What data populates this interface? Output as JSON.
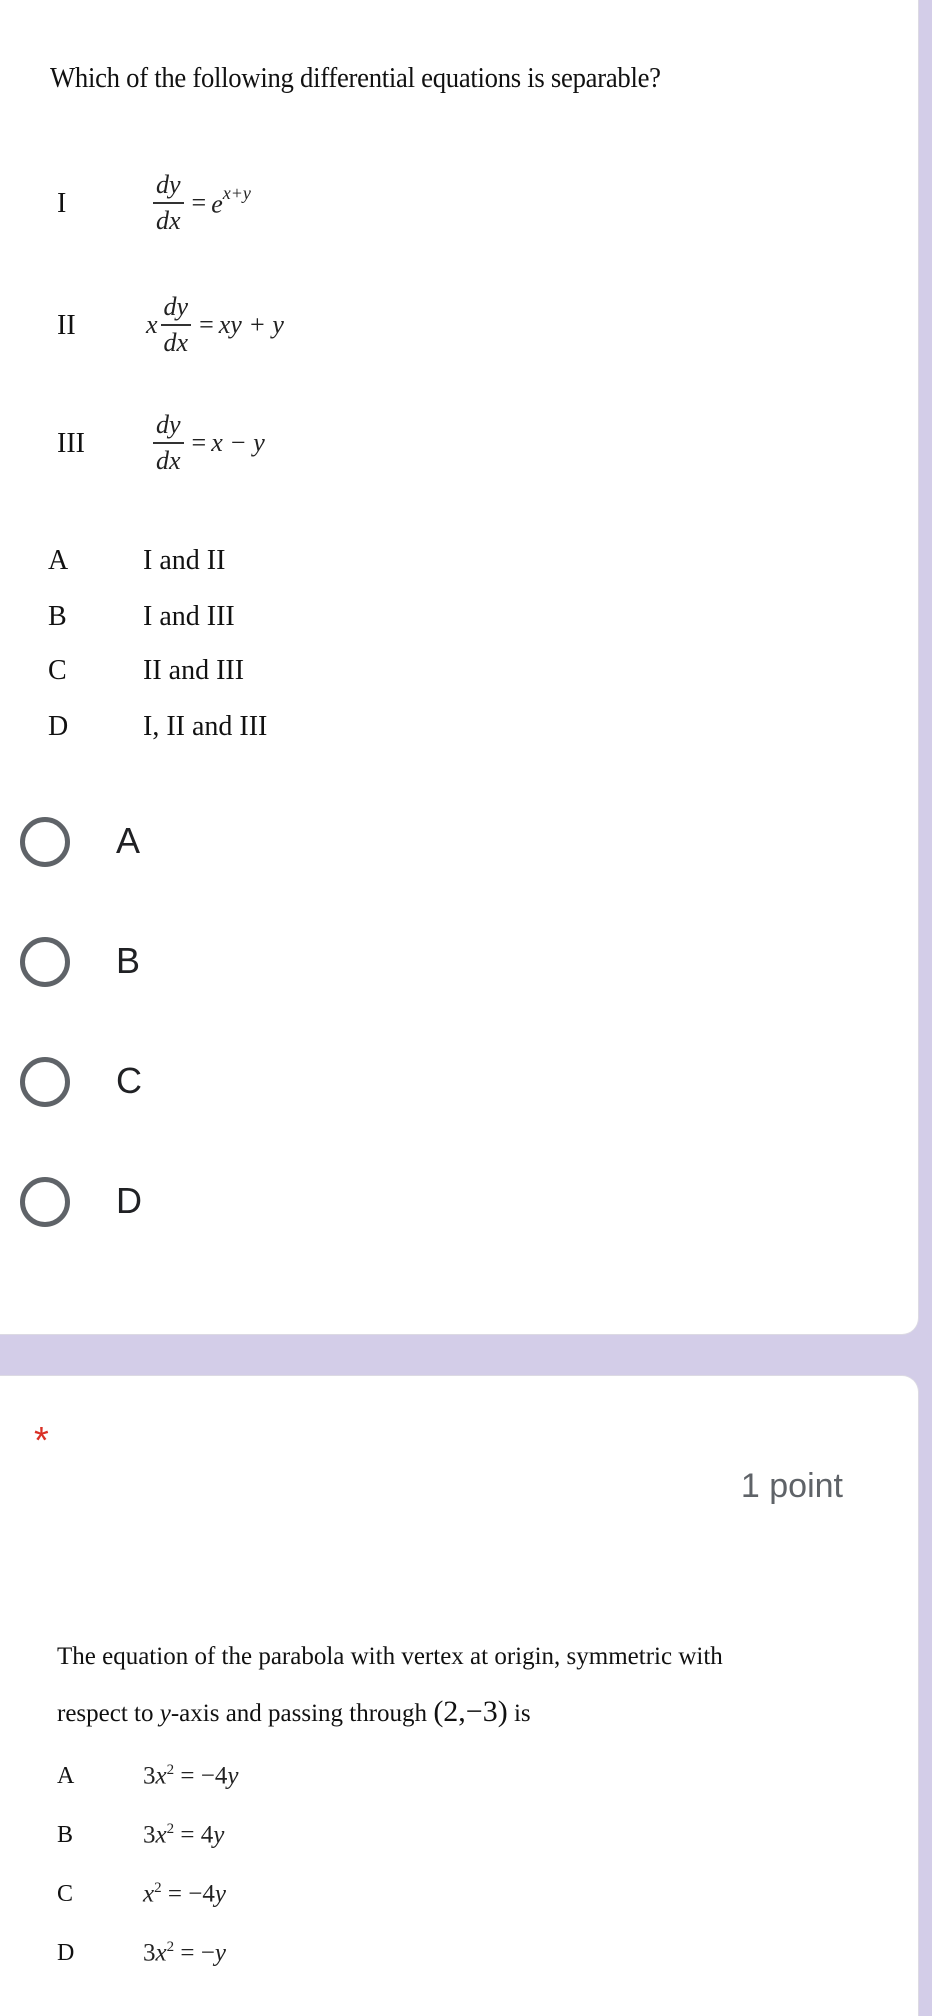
{
  "question1": {
    "title": "Which of the following differential equations is separable?",
    "statements": [
      {
        "label": "I",
        "prefix": "",
        "num": "dy",
        "den": "dx",
        "op": "=",
        "rhs_base": "e",
        "rhs_sup": "x+y",
        "rhs": ""
      },
      {
        "label": "II",
        "prefix": "x",
        "num": "dy",
        "den": "dx",
        "op": "=",
        "rhs_base": "",
        "rhs_sup": "",
        "rhs": "xy + y"
      },
      {
        "label": "III",
        "prefix": "",
        "num": "dy",
        "den": "dx",
        "op": "=",
        "rhs_base": "",
        "rhs_sup": "",
        "rhs": "x − y"
      }
    ],
    "options": [
      {
        "label": "A",
        "text": "I and II"
      },
      {
        "label": "B",
        "text": "I and III"
      },
      {
        "label": "C",
        "text": "II and III"
      },
      {
        "label": "D",
        "text": "I, II and III"
      }
    ],
    "choices": [
      {
        "label": "A",
        "selected": false
      },
      {
        "label": "B",
        "selected": false
      },
      {
        "label": "C",
        "selected": false
      },
      {
        "label": "D",
        "selected": false
      }
    ]
  },
  "question2": {
    "required_mark": "*",
    "points": "1 point",
    "text_line1": "The equation of the parabola with vertex at origin, symmetric with",
    "text_line2_a": "respect to ",
    "text_line2_var": "y",
    "text_line2_b": "-axis and passing through ",
    "text_line2_point": "(2,−3)",
    "text_line2_c": " is",
    "options": [
      {
        "label": "A",
        "coef": "3",
        "var": "x",
        "exp": "2",
        "op": " = ",
        "rhs_num": "−4",
        "rhs_var": "y"
      },
      {
        "label": "B",
        "coef": "3",
        "var": "x",
        "exp": "2",
        "op": " = ",
        "rhs_num": "4",
        "rhs_var": "y"
      },
      {
        "label": "C",
        "coef": "",
        "var": "x",
        "exp": "2",
        "op": " = ",
        "rhs_num": "−4",
        "rhs_var": "y"
      },
      {
        "label": "D",
        "coef": "3",
        "var": "x",
        "exp": "2",
        "op": " = ",
        "rhs_num": "−",
        "rhs_var": "y"
      }
    ]
  },
  "colors": {
    "background": "#d3cde8",
    "card": "#ffffff",
    "radio_border": "#5f6368",
    "required": "#d93025",
    "points_text": "#5f6368"
  }
}
